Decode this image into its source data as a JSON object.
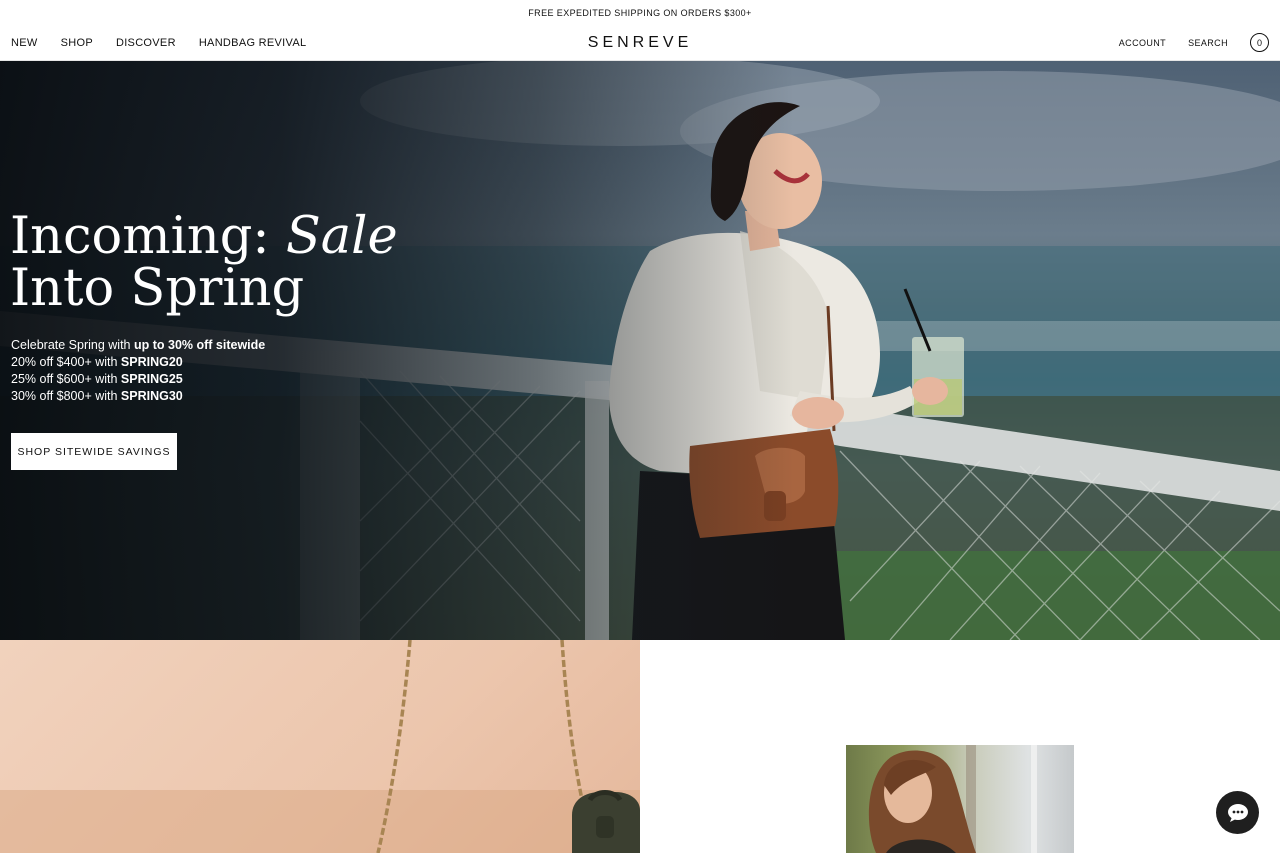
{
  "announcement": "FREE EXPEDITED SHIPPING ON ORDERS $300+",
  "nav": {
    "left": [
      "NEW",
      "SHOP",
      "DISCOVER",
      "HANDBAG REVIVAL"
    ],
    "logo": "SENREVE",
    "account": "ACCOUNT",
    "search": "SEARCH",
    "cart_count": "0"
  },
  "hero": {
    "title_line1_plain": "Incoming: ",
    "title_line1_italic": "Sale",
    "title_line2": "Into Spring",
    "intro_plain": "Celebrate Spring with ",
    "intro_bold": "up to 30% off sitewide",
    "offers": [
      {
        "text": "20% off $400+ with ",
        "code": "SPRING20"
      },
      {
        "text": "25% off $600+ with ",
        "code": "SPRING25"
      },
      {
        "text": "30% off $800+ with ",
        "code": "SPRING30"
      }
    ],
    "cta": "SHOP SITEWIDE SAVINGS"
  },
  "icons": {
    "cart": "cart-count-icon",
    "chat": "chat-bubble-icon"
  },
  "colors": {
    "text": "#111111",
    "hero_text": "#ffffff",
    "chat_button": "#1f1f1f",
    "promo_panel": "#f1d2bd"
  }
}
